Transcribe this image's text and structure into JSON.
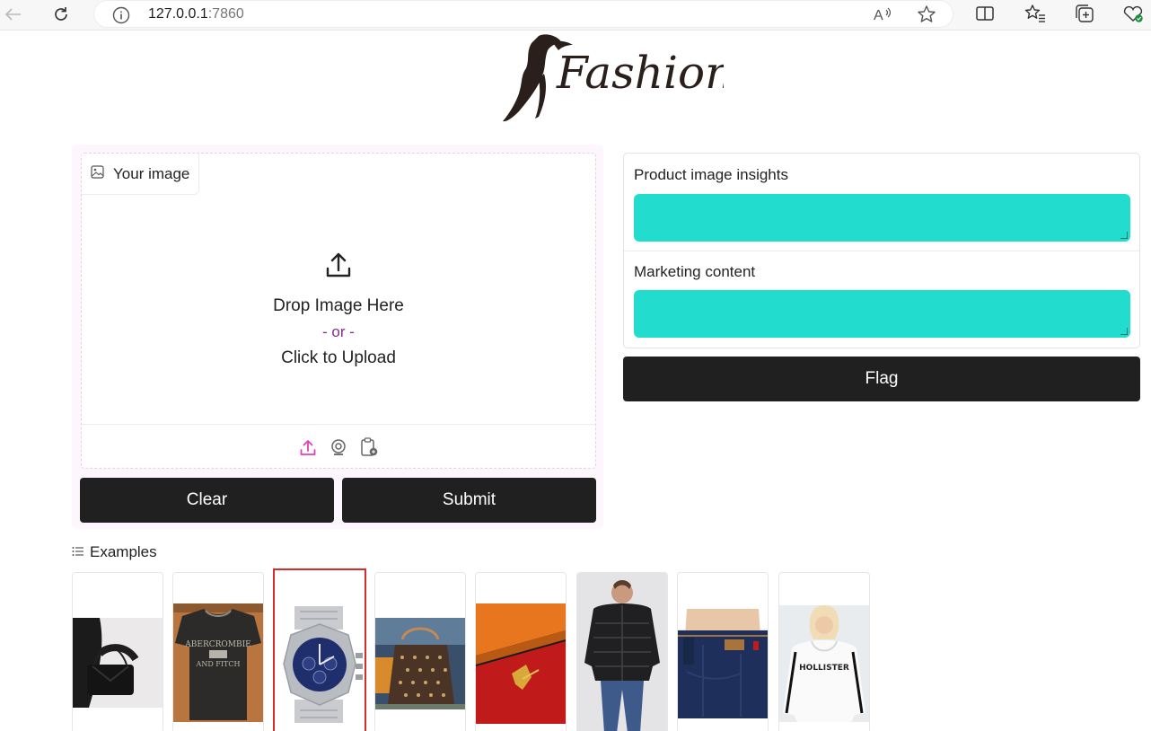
{
  "browser": {
    "url_host": "127.0.0.1",
    "url_port": ":7860",
    "icons": [
      "back-icon",
      "reload-icon",
      "info-icon",
      "read-aloud-icon",
      "favorite-icon",
      "split-screen-icon",
      "favorites-icon",
      "collections-icon",
      "browser-essentials-icon"
    ]
  },
  "logo": {
    "text": "Fashion"
  },
  "input": {
    "label": "Your image",
    "drop_text": "Drop Image Here",
    "or_text": "- or -",
    "click_text": "Click to Upload",
    "sources": [
      "upload-icon",
      "webcam-icon",
      "clipboard-icon"
    ]
  },
  "buttons": {
    "clear": "Clear",
    "submit": "Submit",
    "flag": "Flag"
  },
  "outputs": {
    "insights_label": "Product image insights",
    "insights_value": "",
    "marketing_label": "Marketing content",
    "marketing_value": ""
  },
  "examples": {
    "label": "Examples",
    "items": [
      "black-handbag",
      "graphic-tshirt",
      "chronograph-watch",
      "monogram-tote",
      "orange-gift-box",
      "puffer-jacket",
      "denim-jeans",
      "white-hoodie"
    ],
    "selected_index": 2
  },
  "colors": {
    "accent_teal": "#22ddcd",
    "dark_button": "#202020",
    "upload_pink": "#e040c0",
    "selected_border": "#d92b2b"
  }
}
